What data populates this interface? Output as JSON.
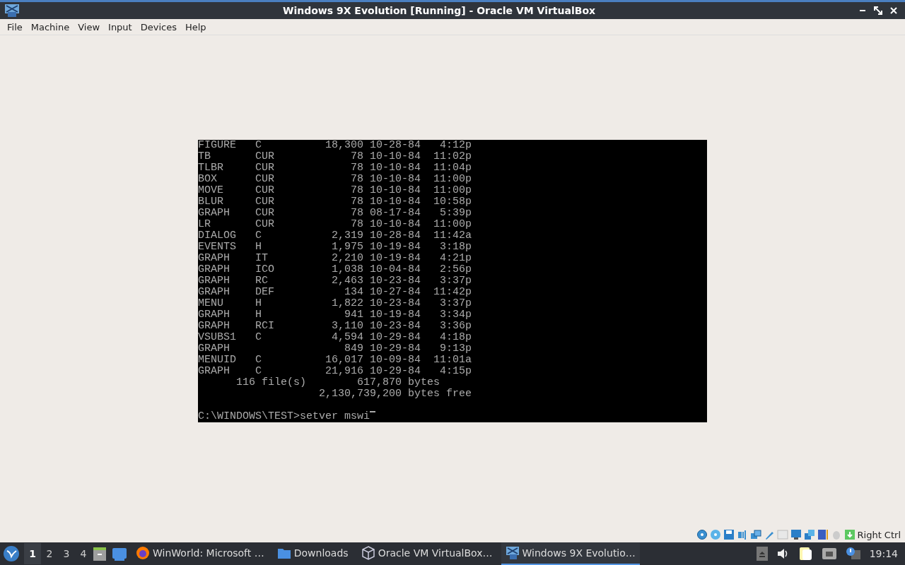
{
  "window": {
    "title": "Windows 9X Evolution [Running] - Oracle VM VirtualBox"
  },
  "menu": [
    "File",
    "Machine",
    "View",
    "Input",
    "Devices",
    "Help"
  ],
  "terminal": {
    "rows": [
      {
        "name": "FIGURE",
        "ext": "C",
        "size": "18,300",
        "date": "10-28-84",
        "time": "4:12p"
      },
      {
        "name": "TB",
        "ext": "CUR",
        "size": "78",
        "date": "10-10-84",
        "time": "11:02p"
      },
      {
        "name": "TLBR",
        "ext": "CUR",
        "size": "78",
        "date": "10-10-84",
        "time": "11:04p"
      },
      {
        "name": "BOX",
        "ext": "CUR",
        "size": "78",
        "date": "10-10-84",
        "time": "11:00p"
      },
      {
        "name": "MOVE",
        "ext": "CUR",
        "size": "78",
        "date": "10-10-84",
        "time": "11:00p"
      },
      {
        "name": "BLUR",
        "ext": "CUR",
        "size": "78",
        "date": "10-10-84",
        "time": "10:58p"
      },
      {
        "name": "GRAPH",
        "ext": "CUR",
        "size": "78",
        "date": "08-17-84",
        "time": "5:39p"
      },
      {
        "name": "LR",
        "ext": "CUR",
        "size": "78",
        "date": "10-10-84",
        "time": "11:00p"
      },
      {
        "name": "DIALOG",
        "ext": "C",
        "size": "2,319",
        "date": "10-28-84",
        "time": "11:42a"
      },
      {
        "name": "EVENTS",
        "ext": "H",
        "size": "1,975",
        "date": "10-19-84",
        "time": "3:18p"
      },
      {
        "name": "GRAPH",
        "ext": "IT",
        "size": "2,210",
        "date": "10-19-84",
        "time": "4:21p"
      },
      {
        "name": "GRAPH",
        "ext": "ICO",
        "size": "1,038",
        "date": "10-04-84",
        "time": "2:56p"
      },
      {
        "name": "GRAPH",
        "ext": "RC",
        "size": "2,463",
        "date": "10-23-84",
        "time": "3:37p"
      },
      {
        "name": "GRAPH",
        "ext": "DEF",
        "size": "134",
        "date": "10-27-84",
        "time": "11:42p"
      },
      {
        "name": "MENU",
        "ext": "H",
        "size": "1,822",
        "date": "10-23-84",
        "time": "3:37p"
      },
      {
        "name": "GRAPH",
        "ext": "H",
        "size": "941",
        "date": "10-19-84",
        "time": "3:34p"
      },
      {
        "name": "GRAPH",
        "ext": "RCI",
        "size": "3,110",
        "date": "10-23-84",
        "time": "3:36p"
      },
      {
        "name": "VSUBS1",
        "ext": "C",
        "size": "4,594",
        "date": "10-29-84",
        "time": "4:18p"
      },
      {
        "name": "GRAPH",
        "size": "849",
        "date": "10-29-84",
        "time": "9:13p"
      },
      {
        "name": "MENUID",
        "ext": "C",
        "size": "16,017",
        "date": "10-09-84",
        "time": "11:01a"
      },
      {
        "name": "GRAPH",
        "ext": "C",
        "size": "21,916",
        "date": "10-29-84",
        "time": "4:15p"
      }
    ],
    "file_count": "116 file(s)",
    "total_bytes": "617,870 bytes",
    "free_bytes": "2,130,739,200 bytes free",
    "prompt": "C:\\WINDOWS\\TEST>setver mswi"
  },
  "status_hint": "Right Ctrl",
  "taskbar": {
    "workspaces": [
      {
        "label": "1",
        "selected": true
      },
      {
        "label": "2",
        "selected": false
      },
      {
        "label": "3",
        "selected": false
      },
      {
        "label": "4",
        "selected": false
      }
    ],
    "tasks": [
      {
        "kind": "browser",
        "label": "WinWorld: Microsoft …",
        "selected": false
      },
      {
        "kind": "folder",
        "label": "Downloads",
        "selected": false
      },
      {
        "kind": "cube",
        "label": "Oracle VM VirtualBox…",
        "selected": false
      },
      {
        "kind": "vm",
        "label": "Windows 9X Evolutio…",
        "selected": true
      }
    ],
    "clock": "19:14"
  }
}
